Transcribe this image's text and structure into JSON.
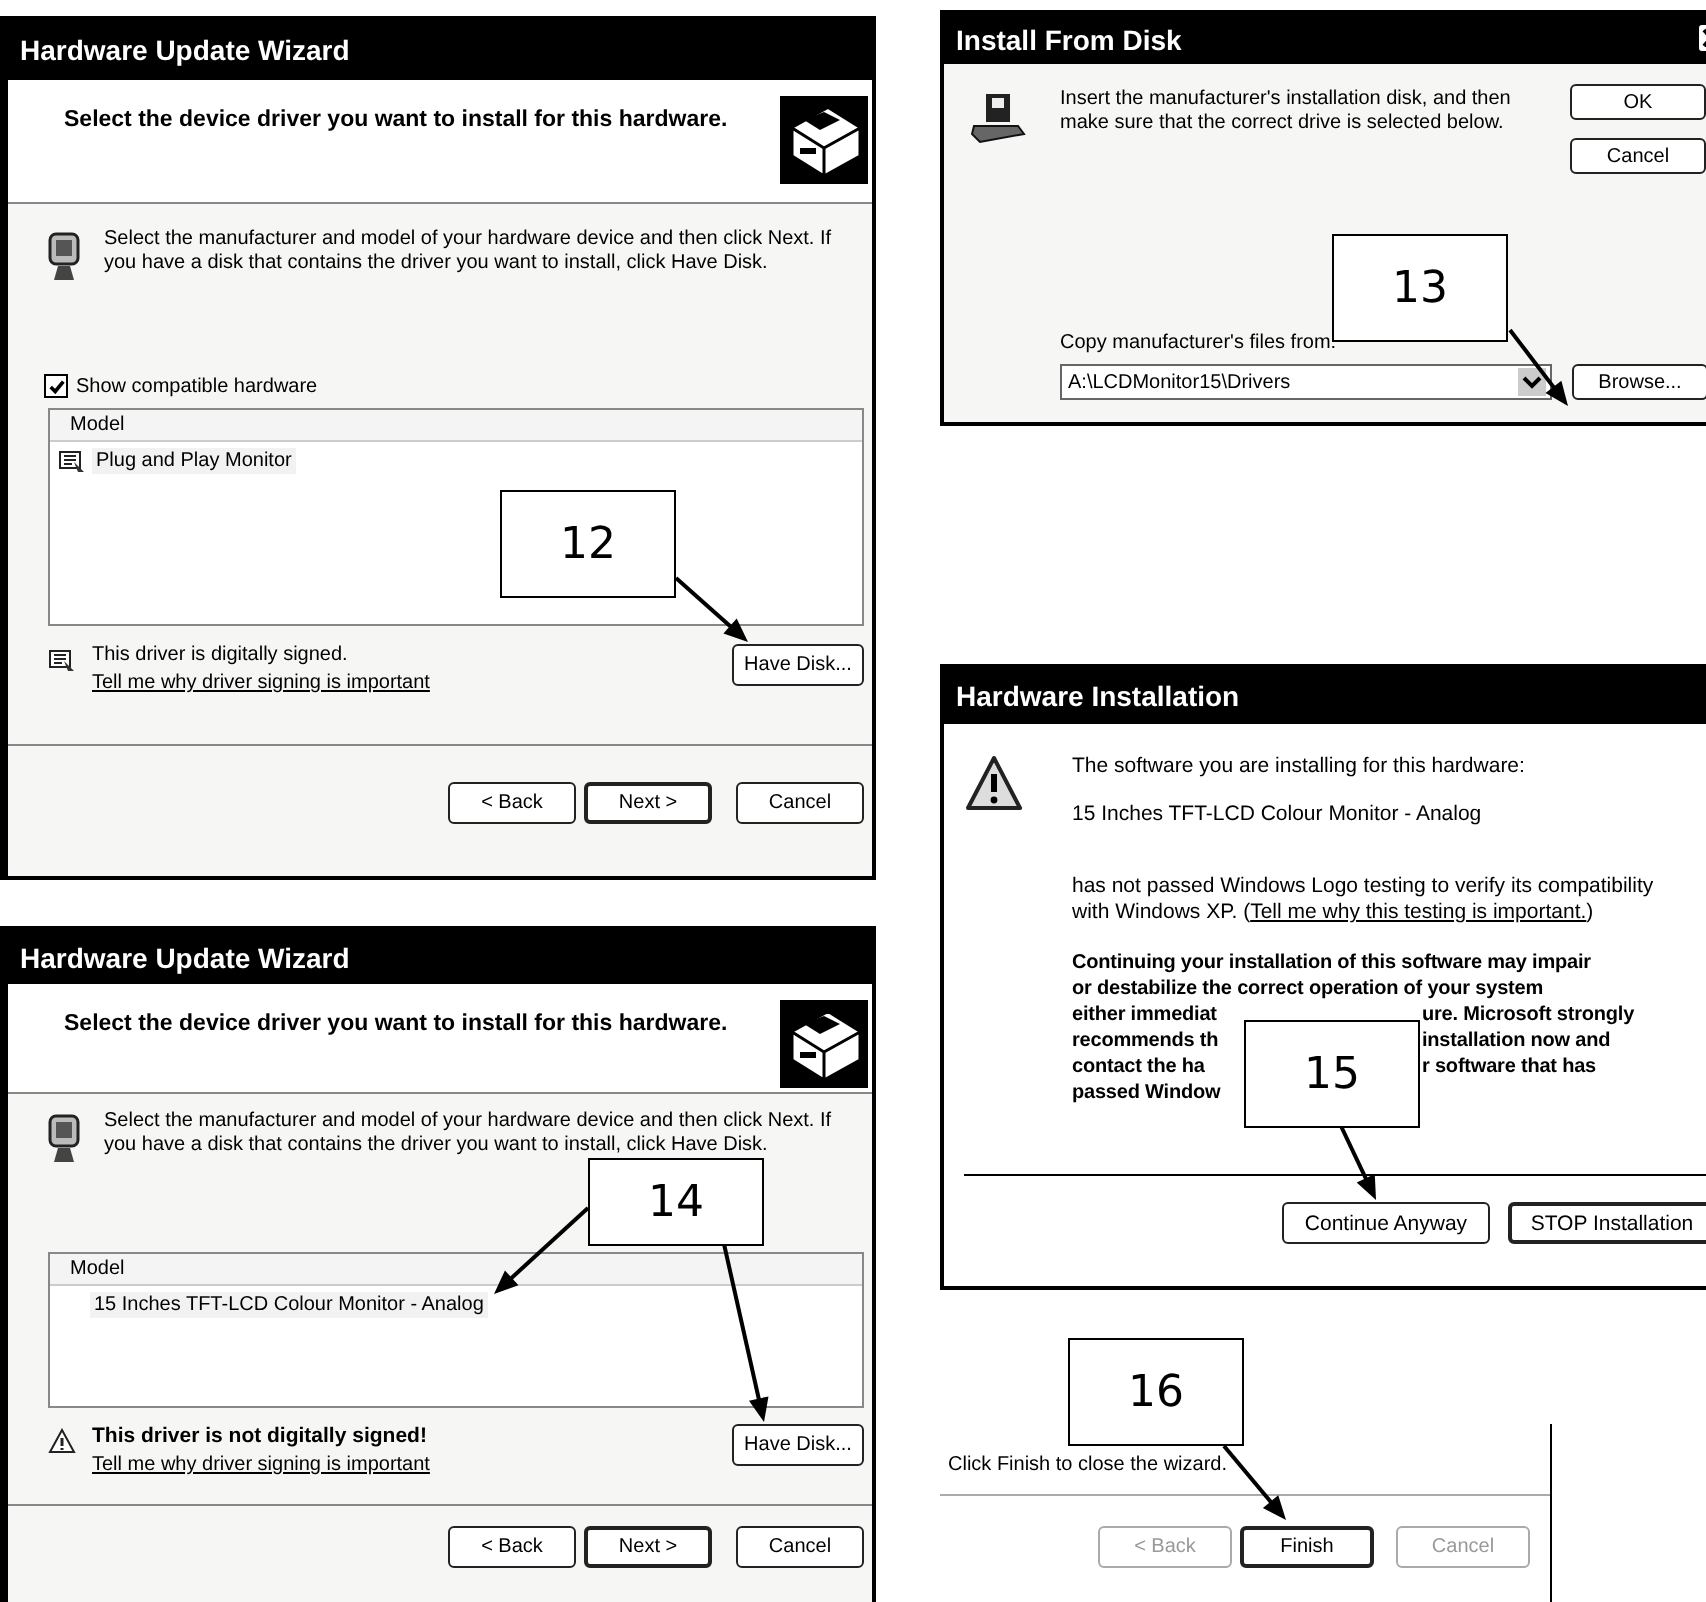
{
  "wizards": [
    {
      "title": "Hardware Update Wizard",
      "heading": "Select the device driver you want to install for this hardware.",
      "instructions": "Select the manufacturer and model of your hardware device and then click Next. If you have a disk that contains the driver you want to install, click Have Disk.",
      "compatible_checkbox": {
        "label": "Show compatible hardware",
        "checked": true
      },
      "list": {
        "column": "Model",
        "items": [
          {
            "label": "Plug and Play Monitor",
            "kind": "driver"
          }
        ]
      },
      "signing": {
        "kind": "signed",
        "message": "This driver is digitally signed.",
        "link": "Tell me why driver signing is important"
      },
      "have_disk": "Have Disk...",
      "buttons": [
        {
          "label": "< Back",
          "default": false
        },
        {
          "label": "Next >",
          "default": true
        },
        {
          "label": "Cancel",
          "default": false
        }
      ]
    },
    {
      "title": "Hardware Update Wizard",
      "heading": "Select the device driver you want to install for this hardware.",
      "instructions": "Select the manufacturer and model of your hardware device and then click Next. If you have a disk that contains the driver you want to install, click Have Disk.",
      "list": {
        "column": "Model",
        "items": [
          {
            "label": "15 Inches TFT-LCD Colour Monitor - Analog",
            "kind": "plain"
          }
        ]
      },
      "signing": {
        "kind": "unsigned",
        "message": "This driver is not digitally signed!",
        "link": "Tell me why driver signing is important"
      },
      "have_disk": "Have Disk...",
      "buttons": [
        {
          "label": "< Back",
          "default": false
        },
        {
          "label": "Next >",
          "default": true
        },
        {
          "label": "Cancel",
          "default": false
        }
      ]
    }
  ],
  "install_from_disk": {
    "title": "Install From Disk",
    "message": "Insert the manufacturer's installation disk, and then make sure that the correct drive is selected below.",
    "buttons": [
      {
        "label": "OK"
      },
      {
        "label": "Cancel"
      }
    ],
    "path_label": "Copy manufacturer's files from:",
    "path_value": "A:\\LCDMonitor15\\Drivers",
    "browse": "Browse..."
  },
  "hardware_installation": {
    "title": "Hardware Installation",
    "intro": "The software you are installing for this hardware:",
    "device": "15 Inches TFT-LCD Colour Monitor - Analog",
    "notice_before": "has not passed Windows Logo testing to verify its compatibility with Windows XP. (",
    "notice_link": "Tell me why this testing is important.",
    "notice_after": ")",
    "warning_lines": [
      {
        "parts": [
          "Continuing your installation of this software may impair"
        ]
      },
      {
        "parts": [
          "or destabilize the correct operation of your system"
        ]
      },
      {
        "parts": [
          "either immediat",
          "ure. Microsoft strongly"
        ]
      },
      {
        "parts": [
          "recommends th",
          "installation now and"
        ]
      },
      {
        "parts": [
          "contact the ha",
          "r software that has"
        ]
      },
      {
        "parts": [
          "passed Window"
        ]
      }
    ],
    "buttons": [
      {
        "label": "Continue Anyway",
        "default": false
      },
      {
        "label": "STOP Installation",
        "default": true
      }
    ]
  },
  "finish_step": {
    "message": "Click Finish to close the wizard.",
    "buttons": [
      {
        "label": "< Back",
        "disabled": true,
        "default": false
      },
      {
        "label": "Finish",
        "disabled": false,
        "default": true
      },
      {
        "label": "Cancel",
        "disabled": true,
        "default": false
      }
    ]
  },
  "callouts": [
    {
      "number": "12"
    },
    {
      "number": "13"
    },
    {
      "number": "14"
    },
    {
      "number": "15"
    },
    {
      "number": "16"
    }
  ]
}
